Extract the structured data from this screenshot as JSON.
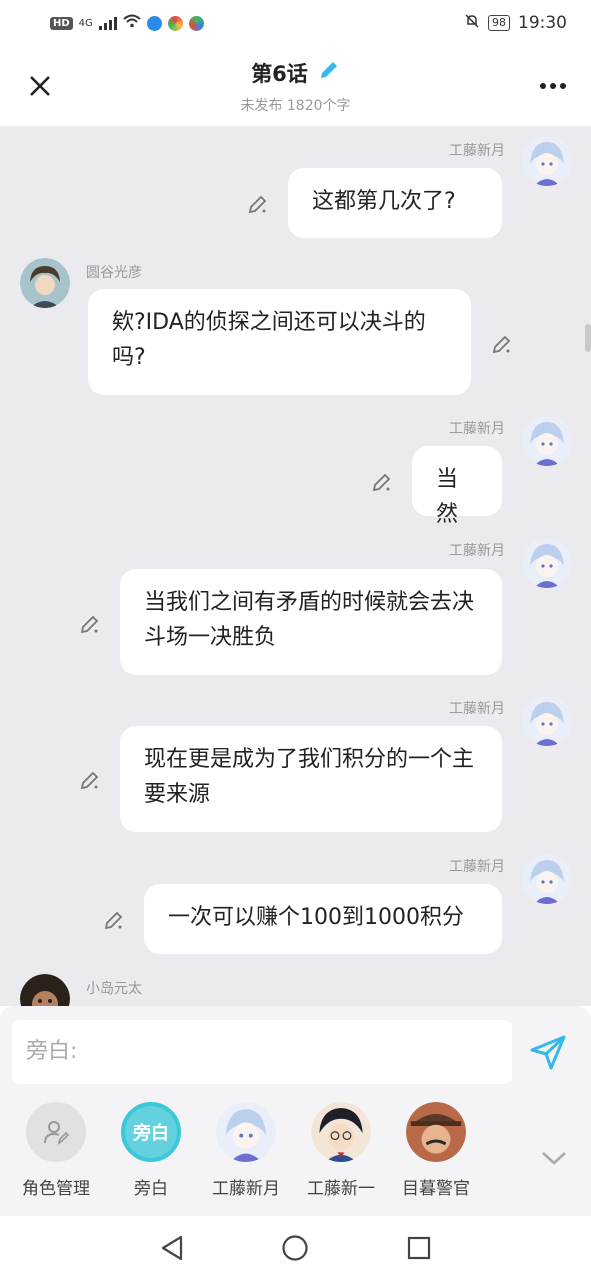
{
  "status_bar": {
    "hd_badge": "HD",
    "signal": "4G",
    "battery": "98",
    "time": "19:30"
  },
  "header": {
    "title": "第6话",
    "subtitle": "未发布 1820个字"
  },
  "messages": [
    {
      "speaker": "工藤新月",
      "side": "right",
      "text": "这都第几次了?"
    },
    {
      "speaker": "圆谷光彦",
      "side": "left",
      "text": "欸?IDA的侦探之间还可以决斗的吗?"
    },
    {
      "speaker": "工藤新月",
      "side": "right",
      "text": "当然"
    },
    {
      "speaker": "工藤新月",
      "side": "right",
      "text": "当我们之间有矛盾的时候就会去决斗场一决胜负"
    },
    {
      "speaker": "工藤新月",
      "side": "right",
      "text": "现在更是成为了我们积分的一个主要来源"
    },
    {
      "speaker": "工藤新月",
      "side": "right",
      "text": "一次可以赚个100到1000积分"
    },
    {
      "speaker": "小岛元太",
      "side": "left",
      "text": ""
    }
  ],
  "input": {
    "placeholder": "旁白:"
  },
  "roles": [
    {
      "label": "角色管理",
      "icon": "person-edit-icon"
    },
    {
      "label": "旁白",
      "badge": "旁白"
    },
    {
      "label": "工藤新月",
      "icon": "avatar-anime-girl"
    },
    {
      "label": "工藤新一",
      "icon": "avatar-conan"
    },
    {
      "label": "目暮警官",
      "icon": "avatar-megure"
    }
  ],
  "colors": {
    "accent": "#35b9e9",
    "chat_bg": "#ebebef",
    "bubble": "#ffffff"
  }
}
